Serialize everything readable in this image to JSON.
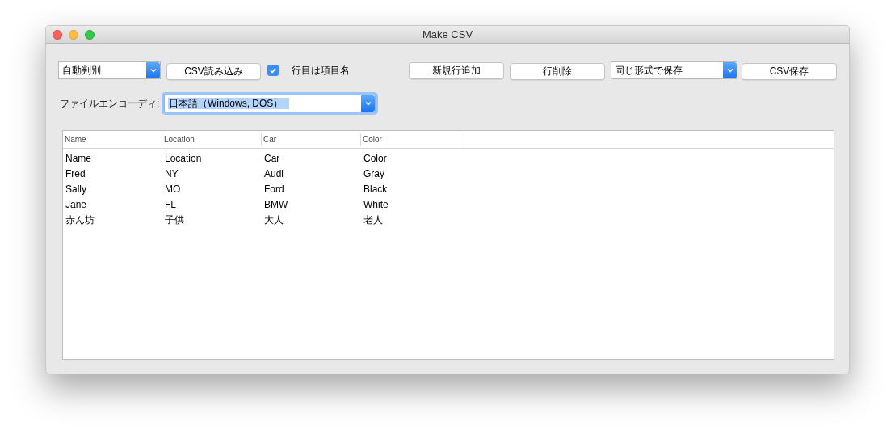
{
  "window": {
    "title": "Make CSV"
  },
  "toolbar": {
    "read_mode": {
      "value": "自動判別"
    },
    "load_button": "CSV読み込み",
    "header_checkbox": {
      "label": "一行目は項目名",
      "checked": true
    },
    "add_row_button": "新規行追加",
    "delete_row_button": "行削除",
    "save_mode": {
      "value": "同じ形式で保存"
    },
    "save_button": "CSV保存"
  },
  "encoding": {
    "label": "ファイルエンコーディ:",
    "value": "日本語（Windows, DOS）",
    "text_selected": true
  },
  "table": {
    "columns": [
      "Name",
      "Location",
      "Car",
      "Color"
    ],
    "rows": [
      [
        "Name",
        "Location",
        "Car",
        "Color"
      ],
      [
        "Fred",
        "NY",
        "Audi",
        "Gray"
      ],
      [
        "Sally",
        "MO",
        "Ford",
        "Black"
      ],
      [
        "Jane",
        "FL",
        "BMW",
        "White"
      ],
      [
        "赤ん坊",
        "子供",
        "大人",
        "老人"
      ]
    ]
  }
}
